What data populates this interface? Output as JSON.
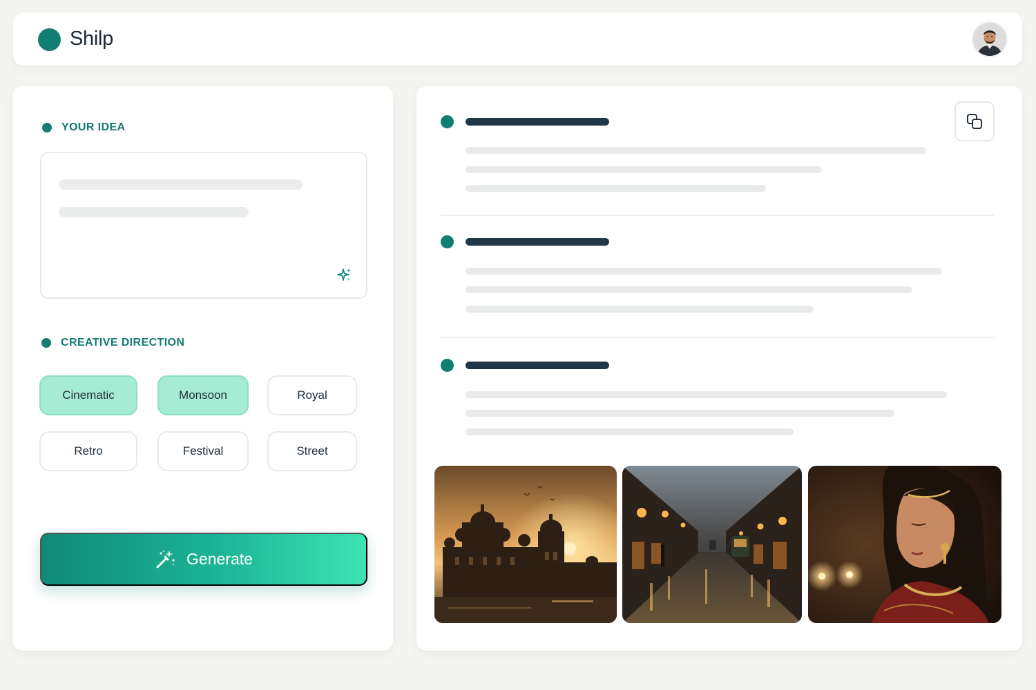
{
  "header": {
    "brand": "Shilp",
    "brand_color": "#117e72"
  },
  "left_panel": {
    "idea_label": "YOUR IDEA",
    "direction_label": "CREATIVE DIRECTION",
    "chips": [
      {
        "label": "Cinematic",
        "selected": true
      },
      {
        "label": "Monsoon",
        "selected": true
      },
      {
        "label": "Royal",
        "selected": false
      },
      {
        "label": "Retro",
        "selected": false
      },
      {
        "label": "Festival",
        "selected": false
      },
      {
        "label": "Street",
        "selected": false
      }
    ],
    "generate_label": "Generate",
    "accent_color": "#127a6e",
    "chip_selected_color": "#a6ebd3"
  },
  "right_panel": {
    "icons": [
      "copy-icon"
    ],
    "images": [
      "palace-sunset-image",
      "rainy-street-image",
      "bridal-portrait-image"
    ]
  }
}
